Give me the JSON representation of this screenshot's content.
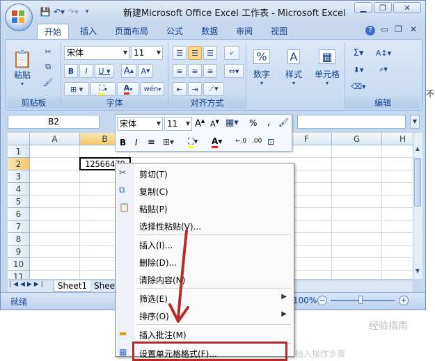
{
  "window": {
    "title": "新建Microsoft Office Excel 工作表 - Microsoft Excel"
  },
  "tabs": [
    {
      "label": "开始"
    },
    {
      "label": "插入"
    },
    {
      "label": "页面布局"
    },
    {
      "label": "公式"
    },
    {
      "label": "数据"
    },
    {
      "label": "审阅"
    },
    {
      "label": "视图"
    }
  ],
  "ribbon": {
    "clipboard": {
      "label": "剪贴板",
      "paste": "粘贴"
    },
    "font": {
      "label": "字体",
      "font_name": "宋体",
      "font_size": "11",
      "phonetic": "wén"
    },
    "alignment": {
      "label": "对齐方式"
    },
    "number": {
      "label": "数字"
    },
    "styles": {
      "label": "样式"
    },
    "cells": {
      "label": "单元格"
    },
    "editing": {
      "label": "编辑"
    }
  },
  "formula_bar": {
    "name_box": "B2"
  },
  "columns": [
    "A",
    "B",
    "F",
    "G",
    "H"
  ],
  "rows": [
    "1",
    "2",
    "3",
    "4",
    "5",
    "6",
    "7",
    "8",
    "9",
    "10",
    "11"
  ],
  "cell_b2": "12566479",
  "sheet_tabs": [
    "Sheet1",
    "Shee"
  ],
  "status": {
    "ready": "就绪",
    "zoom": "100%"
  },
  "mini_toolbar": {
    "font_name": "宋体",
    "font_size": "11"
  },
  "context_menu": {
    "items": [
      {
        "label": "剪切(T)"
      },
      {
        "label": "复制(C)"
      },
      {
        "label": "粘贴(P)"
      },
      {
        "label": "选择性粘贴(V)..."
      },
      {
        "label": "插入(I)..."
      },
      {
        "label": "删除(D)..."
      },
      {
        "label": "清除内容(N)"
      },
      {
        "label": "筛选(E)"
      },
      {
        "label": "排序(O)"
      },
      {
        "label": "插入批注(M)"
      },
      {
        "label": "设置单元格格式(F)..."
      }
    ]
  },
  "background_text": {
    "right_fragment": "不怕",
    "watermark": "经验指南",
    "bottom_fragment": "插入操作步骤"
  },
  "colors": {
    "accent": "#15428b",
    "highlight": "#b32b2b",
    "ribbon": "#c3d8f0"
  }
}
